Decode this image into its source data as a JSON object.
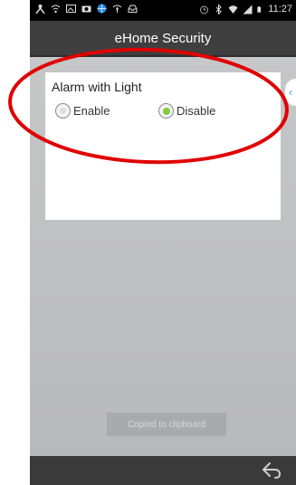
{
  "status_bar": {
    "time": "11:27",
    "left_icons": [
      "person-icon",
      "wifi-icon",
      "image-icon",
      "camera-icon",
      "globe-icon",
      "location-icon",
      "inbox-icon"
    ],
    "right_icons": [
      "alarm-icon",
      "bluetooth-icon",
      "wifi-icon",
      "signal-icon",
      "battery-icon"
    ]
  },
  "app_title": "eHome Security",
  "card": {
    "title": "Alarm with Light",
    "options": [
      {
        "label": "Enable",
        "selected": false
      },
      {
        "label": "Disable",
        "selected": true
      }
    ]
  },
  "side_tab_glyph": "‹",
  "toast": "Copied to clipboard",
  "nav": {
    "icon": "back-icon"
  },
  "colors": {
    "title_bar": "#3f3f3f",
    "background": "#bfc0c2",
    "radio_selected": "#7fce3a",
    "annotation": "#e00000"
  }
}
